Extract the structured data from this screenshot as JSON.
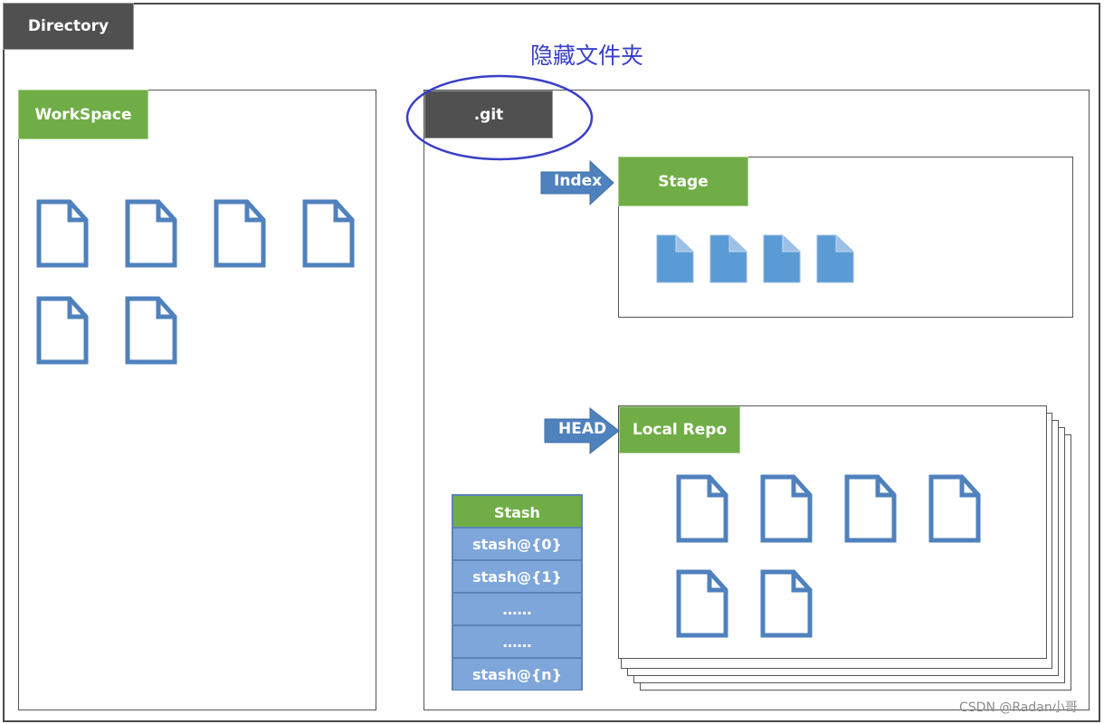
{
  "diagram": {
    "directory_label": "Directory",
    "hidden_folder_caption": "隐藏文件夹",
    "workspace": {
      "label": "WorkSpace",
      "file_count": 6
    },
    "git": {
      "label": ".git"
    },
    "stage": {
      "label": "Stage",
      "pointer": "Index",
      "file_count": 4
    },
    "local_repo": {
      "label": "Local Repo",
      "pointer": "HEAD",
      "file_count": 6
    },
    "stash": {
      "header": "Stash",
      "entries": [
        "stash@{0}",
        "stash@{1}",
        "……",
        "……",
        "stash@{n}"
      ]
    },
    "watermark": "CSDN @Radan小哥",
    "colors": {
      "dark_tab": "#505050",
      "green_tab": "#70AD47",
      "arrow_blue": "#4F81BD",
      "file_outline": "#4F81BD",
      "file_filled": "#5B9BD5",
      "stash_row": "#7EA6DA",
      "caption_blue": "#3A3FC7"
    }
  }
}
